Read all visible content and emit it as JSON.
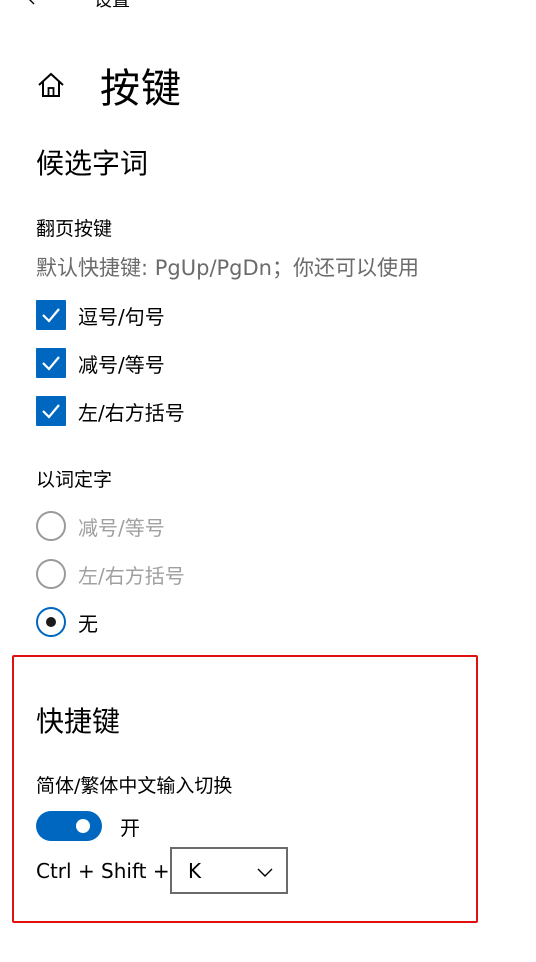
{
  "window": {
    "title": "设置"
  },
  "page": {
    "title": "按键"
  },
  "candidate_words": {
    "section_title": "候选字词",
    "paging_keys": {
      "label": "翻页按键",
      "description": "默认快捷键: PgUp/PgDn；你还可以使用",
      "options": [
        {
          "label": "逗号/句号",
          "checked": true
        },
        {
          "label": "减号/等号",
          "checked": true
        },
        {
          "label": "左/右方括号",
          "checked": true
        }
      ]
    },
    "word_to_char": {
      "label": "以词定字",
      "options": [
        {
          "label": "减号/等号",
          "selected": false,
          "enabled": false
        },
        {
          "label": "左/右方括号",
          "selected": false,
          "enabled": false
        },
        {
          "label": "无",
          "selected": true,
          "enabled": true
        }
      ]
    }
  },
  "shortcuts": {
    "section_title": "快捷键",
    "simplified_traditional": {
      "label": "简体/繁体中文输入切换",
      "toggle_state": "开",
      "toggle_on": true,
      "key_prefix": "Ctrl + Shift +",
      "key_value": "K"
    }
  },
  "colors": {
    "accent": "#0067c0",
    "highlight_border": "#e01010",
    "disabled_text": "#a0a0a0",
    "secondary_text": "#6b6b6b"
  },
  "icons": {
    "back": "back-arrow-icon",
    "home": "home-icon",
    "check": "checkmark-icon",
    "dropdown": "chevron-down-icon"
  }
}
